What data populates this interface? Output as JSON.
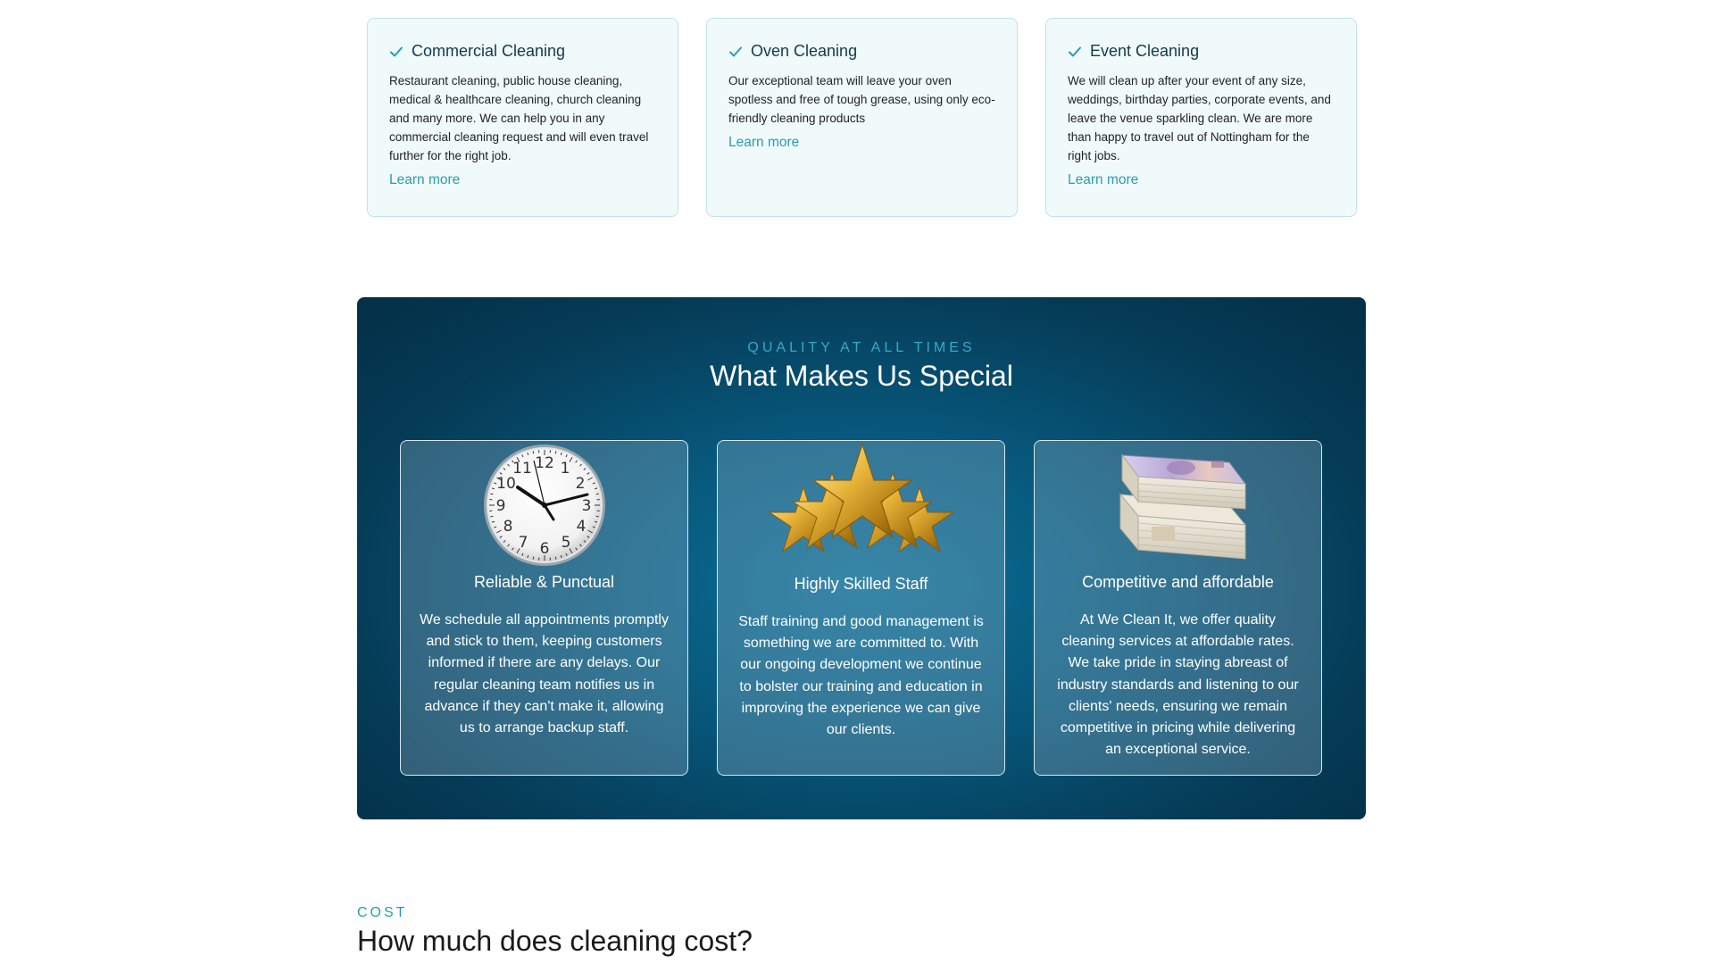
{
  "colors": {
    "accent": "#2a9cb0",
    "panel_dark": "#042f47",
    "panel_mid": "#0b6f97",
    "card_bg": "#f0fafb"
  },
  "services": [
    {
      "icon": "check-icon",
      "title": "Commercial Cleaning",
      "description": "Restaurant cleaning, public house cleaning, medical & healthcare cleaning, church cleaning and many more. We can help you in any commercial cleaning request and will even travel further for the right job.",
      "link": "Learn more"
    },
    {
      "icon": "check-icon",
      "title": "Oven Cleaning",
      "description": "Our exceptional team will leave your oven spotless and free of tough grease, using only eco-friendly cleaning products",
      "link": "Learn more"
    },
    {
      "icon": "check-icon",
      "title": "Event Cleaning",
      "description": "We will clean up after your event of any size, weddings, birthday parties, corporate events, and leave the venue sparkling clean. We are more than happy to travel out of Nottingham for the right jobs.",
      "link": "Learn more"
    }
  ],
  "special": {
    "eyebrow": "QUALITY AT ALL TIMES",
    "title": "What Makes Us Special",
    "features": [
      {
        "icon": "clock-icon",
        "title": "Reliable & Punctual",
        "description": "We schedule all appointments promptly and stick to them, keeping customers informed if there are any delays. Our regular cleaning team notifies us in advance if they can't make it, allowing us to arrange backup staff."
      },
      {
        "icon": "gold-stars-icon",
        "title": "Highly Skilled Staff",
        "description": "Staff training and good management is something we are committed to. With our ongoing development we continue to bolster our training and education in improving the experience we can give our clients."
      },
      {
        "icon": "banknotes-icon",
        "title": "Competitive and affordable",
        "description": "At We Clean It, we offer quality cleaning services at affordable rates. We take pride in staying abreast of industry standards and listening to our clients' needs, ensuring we remain competitive in pricing while delivering an exceptional service."
      }
    ]
  },
  "cost": {
    "eyebrow": "COST",
    "title": "How much does cleaning cost?"
  }
}
